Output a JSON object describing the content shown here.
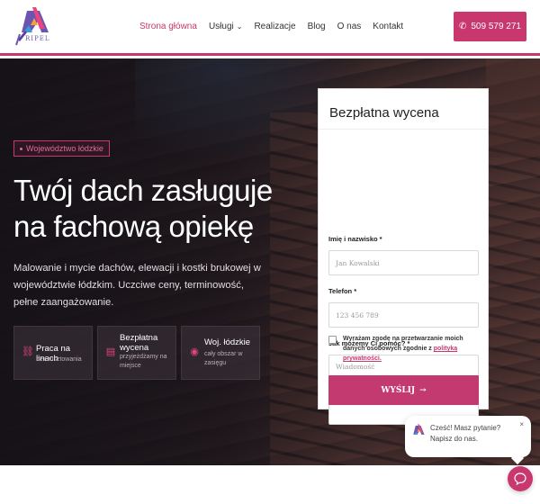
{
  "brand": {
    "logo_text": "RIPEL",
    "accent": "#c8376e"
  },
  "nav": {
    "items": [
      {
        "label": "Strona główna",
        "active": true
      },
      {
        "label": "Usługi",
        "has_dropdown": true
      },
      {
        "label": "Realizacje"
      },
      {
        "label": "Blog"
      },
      {
        "label": "O nas"
      },
      {
        "label": "Kontakt"
      }
    ],
    "phone": "509 579 271"
  },
  "hero": {
    "region_badge": "Województwo łódzkie",
    "title_line1": "Twój dach zasługuje",
    "title_line2": "na fachową opiekę",
    "description": "Malowanie i mycie dachów, elewacji i kostki brukowej w województwie łódzkim. Uczciwe ceny, terminowość, pełne zaangażowanie.",
    "features": [
      {
        "title": "Praca na linach",
        "subtitle": "bez rusztowania",
        "icon": "rope-icon"
      },
      {
        "title": "Bezpłatna wycena",
        "subtitle": "przyjeżdżamy na miejsce",
        "icon": "clipboard-icon"
      },
      {
        "title": "Woj. łódzkie",
        "subtitle": "cały obszar w zasięgu",
        "icon": "map-pin-icon"
      }
    ]
  },
  "form": {
    "title": "Bezpłatna wycena",
    "name_label": "Imię i nazwisko *",
    "name_placeholder": "Jan Kowalski",
    "phone_label": "Telefon *",
    "phone_placeholder": "123 456 789",
    "message_label": "Jak możemy Ci pomóc? *",
    "message_placeholder": "Wiadomość",
    "consent_text": "Wyrażam zgodę na przetwarzanie moich danych osobowych zgodnie z ",
    "consent_link": "polityką prywatności.",
    "submit_label": "WYŚLIJ",
    "submit_arrow": "→"
  },
  "chat": {
    "line1": "Cześć! Masz pytanie?",
    "line2": "Napisz do nas.",
    "close": "×"
  }
}
